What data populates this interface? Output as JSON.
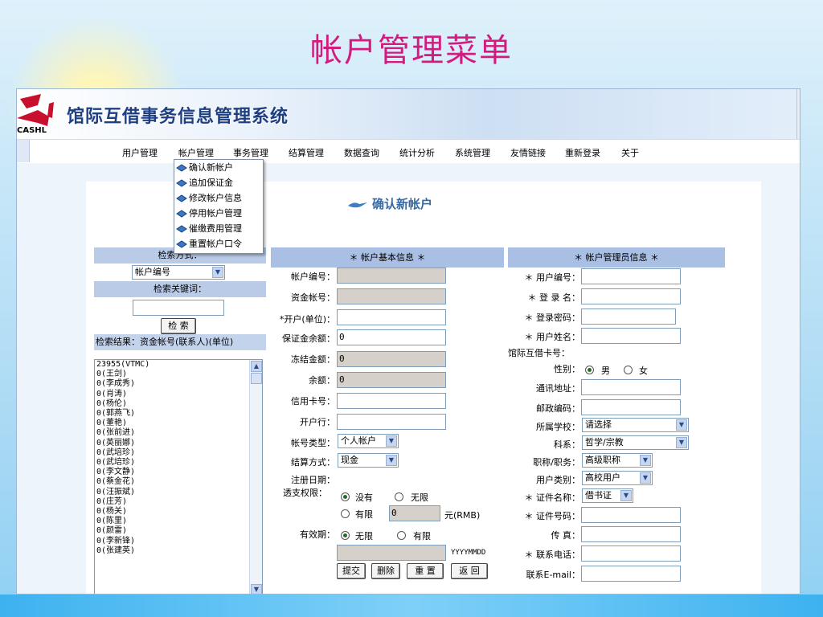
{
  "slide": {
    "title": "帐户管理菜单"
  },
  "banner": {
    "logo_text": "CASHL",
    "system_title": "馆际互借事务信息管理系统"
  },
  "nav": [
    "用户管理",
    "帐户管理",
    "事务管理",
    "结算管理",
    "数据查询",
    "统计分析",
    "系统管理",
    "友情链接",
    "重新登录",
    "关于"
  ],
  "dropdown": [
    "确认新帐户",
    "追加保证金",
    "修改帐户信息",
    "停用帐户管理",
    "催缴费用管理",
    "重置帐户口令"
  ],
  "heading": "确认新帐户",
  "search": {
    "method_label": "检索方式：",
    "method_value": "帐户编号",
    "keyword_label": "检索关键词：",
    "keyword_value": "",
    "button": "检 索",
    "result_label": "检索结果：资金帐号(联系人)(单位)",
    "results": [
      "23955(VTMC)",
      "0(王剑)",
      "0(李成秀)",
      "0(肖涛)",
      "0(杨伦)",
      "0(郭燕飞)",
      "0(董艳)",
      "0(张前进)",
      "0(英丽娜)",
      "0(武培珍)",
      "0(武培珍)",
      "0(李文静)",
      "0(蔡金花)",
      "0(汪振斌)",
      "0(庄芳)",
      "0(杨关)",
      "0(陈里)",
      "0(颜雷)",
      "0(李新锋)",
      "0(张建英)"
    ]
  },
  "account": {
    "header": "＊ 帐户基本信息 ＊",
    "account_no": "帐户编号：",
    "fund_no": "资金帐号：",
    "opener": "*开户(单位)：",
    "deposit_balance": "保证金余额：",
    "deposit_balance_value": "0",
    "frozen": "冻结金额：",
    "frozen_value": "0",
    "balance": "余额：",
    "balance_value": "0",
    "card_no": "信用卡号：",
    "bank": "开户行：",
    "type": "帐号类型：",
    "type_value": "个人帐户",
    "settle": "结算方式：",
    "settle_value": "现金",
    "reg_date": "注册日期：",
    "overdraft": "透支权限：",
    "od_none": "没有",
    "od_unlimited": "无限",
    "od_limited": "有限",
    "od_value": "0",
    "od_unit": "元(RMB)",
    "validity": "有效期：",
    "valid_unlimited": "无限",
    "valid_limited": "有限",
    "date_format": "YYYYMMDD",
    "btn_submit": "提交",
    "btn_delete": "删除",
    "btn_reset": "重 置",
    "btn_back": "返 回"
  },
  "admin": {
    "header": "＊ 帐户管理员信息 ＊",
    "user_no": "＊ 用户编号：",
    "login": "＊ 登 录 名：",
    "password": "＊ 登录密码：",
    "name": "＊ 用户姓名：",
    "ill_card": "馆际互借卡号：",
    "gender": "性别：",
    "male": "男",
    "female": "女",
    "address": "通讯地址：",
    "postcode": "邮政编码：",
    "school": "所属学校：",
    "school_value": "请选择",
    "discipline": "科系：",
    "discipline_value": "哲学/宗教",
    "title": "职称/职务：",
    "title_value": "高级职称",
    "user_type": "用户类别：",
    "user_type_value": "高校用户",
    "id_type": "＊ 证件名称：",
    "id_type_value": "借书证",
    "id_no": "＊ 证件号码：",
    "fax": "传 真：",
    "phone": "＊ 联系电话：",
    "email": "联系E-mail："
  }
}
